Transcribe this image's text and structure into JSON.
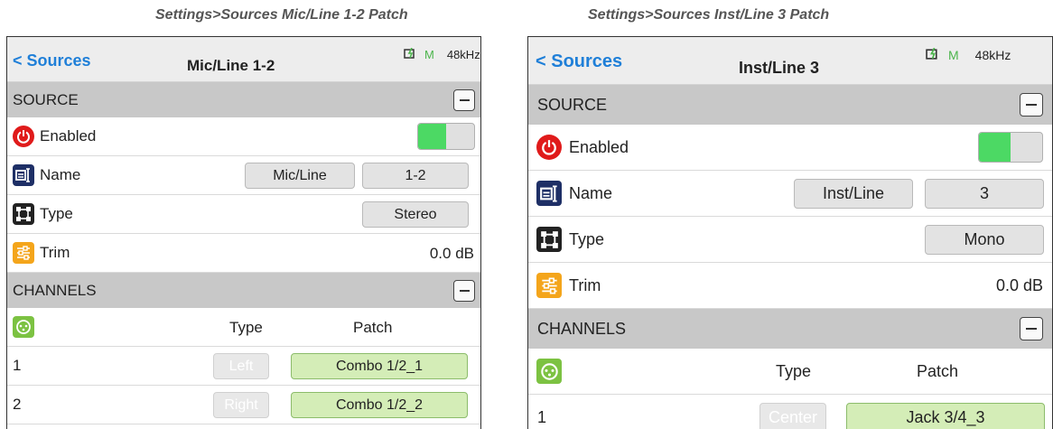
{
  "captions": {
    "left": "Settings>Sources Mic/Line 1-2 Patch",
    "right": "Settings>Sources Inst/Line 3 Patch"
  },
  "colors": {
    "accent_blue": "#1f7fd8",
    "toggle_on": "#4cd964",
    "patch_green": "#d4edb7",
    "section_gray": "#c8c8c8",
    "header_gray": "#ededed",
    "power_red": "#e01b1b",
    "name_navy": "#1e2f66",
    "trim_orange": "#f4a51b",
    "channel_green": "#7cc242"
  },
  "panel_left": {
    "back_label": "< Sources",
    "title": "Mic/Line 1-2",
    "status": {
      "battery_icon": "battery-charging-icon",
      "mode": "M",
      "rate": "48kHz"
    },
    "source_section": {
      "label": "SOURCE",
      "enabled": {
        "icon": "power-icon",
        "label": "Enabled",
        "on": true
      },
      "name": {
        "icon": "name-tag-icon",
        "label": "Name",
        "prefix": "Mic/Line",
        "suffix": "1-2"
      },
      "type": {
        "icon": "type-frame-icon",
        "label": "Type",
        "value": "Stereo"
      },
      "trim": {
        "icon": "sliders-icon",
        "label": "Trim",
        "value": "0.0 dB"
      }
    },
    "channels_section": {
      "label": "CHANNELS",
      "icon": "xlr-connector-icon",
      "col_type": "Type",
      "col_patch": "Patch",
      "rows": [
        {
          "num": "1",
          "type": "Left",
          "patch": "Combo 1/2_1"
        },
        {
          "num": "2",
          "type": "Right",
          "patch": "Combo 1/2_2"
        }
      ]
    }
  },
  "panel_right": {
    "back_label": "< Sources",
    "title": "Inst/Line 3",
    "status": {
      "battery_icon": "battery-charging-icon",
      "mode": "M",
      "rate": "48kHz"
    },
    "source_section": {
      "label": "SOURCE",
      "enabled": {
        "icon": "power-icon",
        "label": "Enabled",
        "on": true
      },
      "name": {
        "icon": "name-tag-icon",
        "label": "Name",
        "prefix": "Inst/Line",
        "suffix": "3"
      },
      "type": {
        "icon": "type-frame-icon",
        "label": "Type",
        "value": "Mono"
      },
      "trim": {
        "icon": "sliders-icon",
        "label": "Trim",
        "value": "0.0 dB"
      }
    },
    "channels_section": {
      "label": "CHANNELS",
      "icon": "xlr-connector-icon",
      "col_type": "Type",
      "col_patch": "Patch",
      "rows": [
        {
          "num": "1",
          "type": "Center",
          "patch": "Jack 3/4_3"
        }
      ]
    }
  }
}
